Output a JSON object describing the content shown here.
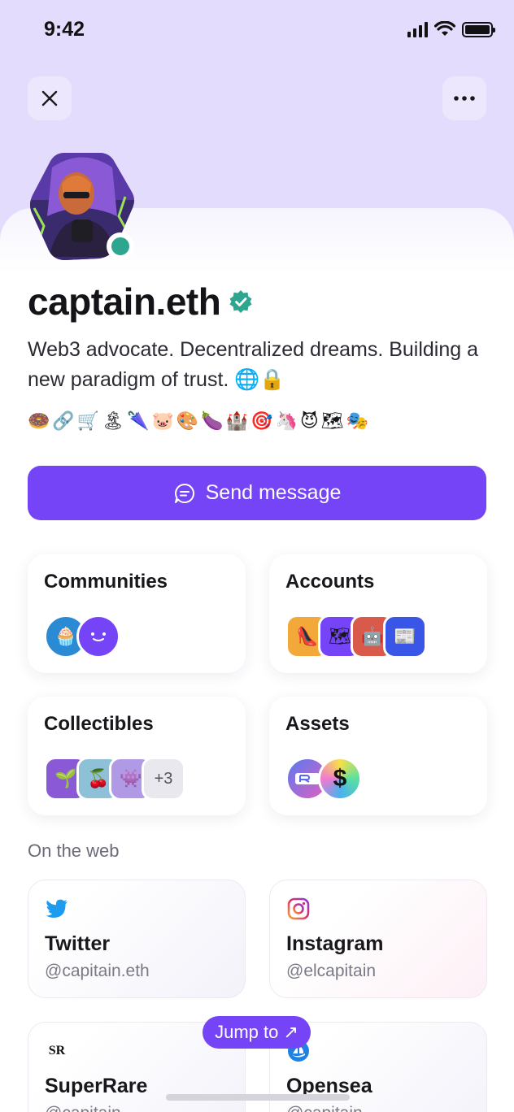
{
  "status_bar": {
    "time": "9:42"
  },
  "profile": {
    "name": "captain.eth",
    "bio": "Web3 advocate. Decentralized dreams. Building a new paradigm of trust. 🌐🔒",
    "emojis": "🍩🔗🛒🏝🌂🐷🎨🍆🏰🎯🦄😈🗺🎭",
    "online": true
  },
  "actions": {
    "send_message": "Send message"
  },
  "cards": {
    "communities": {
      "title": "Communities"
    },
    "accounts": {
      "title": "Accounts"
    },
    "collectibles": {
      "title": "Collectibles",
      "more": "+3"
    },
    "assets": {
      "title": "Assets"
    }
  },
  "web": {
    "section_label": "On the web",
    "links": [
      {
        "name": "Twitter",
        "handle": "@capitain.eth",
        "icon": "twitter-icon"
      },
      {
        "name": "Instagram",
        "handle": "@elcapitain",
        "icon": "instagram-icon"
      },
      {
        "name": "SuperRare",
        "handle": "@capitain",
        "icon": "superrare-icon",
        "icon_text": "SR"
      },
      {
        "name": "Opensea",
        "handle": "@capitain",
        "icon": "opensea-icon"
      }
    ]
  },
  "jump_to": "Jump to ↗",
  "colors": {
    "accent": "#7544f7",
    "online": "#2ea58f",
    "verified": "#2ea58f",
    "header_bg": "#e4dcfc"
  }
}
